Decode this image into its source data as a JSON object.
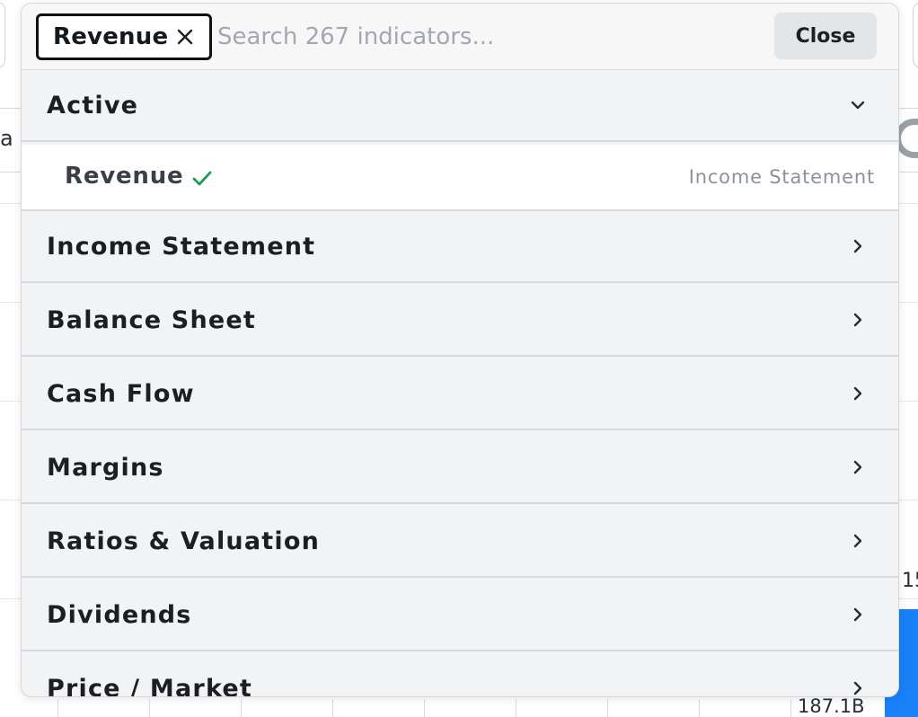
{
  "background": {
    "bar_text": "a I",
    "axis_label": "15",
    "value_label": "187.1B",
    "accent_blue": "#1a80f8"
  },
  "picker": {
    "selected_chip": {
      "label": "Revenue",
      "remove_icon": "close-icon"
    },
    "search": {
      "placeholder": "Search 267 indicators...",
      "value": ""
    },
    "close_label": "Close",
    "active_section": {
      "label": "Active",
      "icon": "chevron-down-icon",
      "items": [
        {
          "label": "Revenue",
          "category": "Income Statement",
          "status_icon": "check-icon",
          "check_color": "#1f9d55"
        }
      ]
    },
    "categories": [
      {
        "label": "Income Statement",
        "icon": "chevron-right-icon"
      },
      {
        "label": "Balance Sheet",
        "icon": "chevron-right-icon"
      },
      {
        "label": "Cash Flow",
        "icon": "chevron-right-icon"
      },
      {
        "label": "Margins",
        "icon": "chevron-right-icon"
      },
      {
        "label": "Ratios & Valuation",
        "icon": "chevron-right-icon"
      },
      {
        "label": "Dividends",
        "icon": "chevron-right-icon"
      },
      {
        "label": "Price / Market",
        "icon": "chevron-right-icon"
      }
    ]
  }
}
